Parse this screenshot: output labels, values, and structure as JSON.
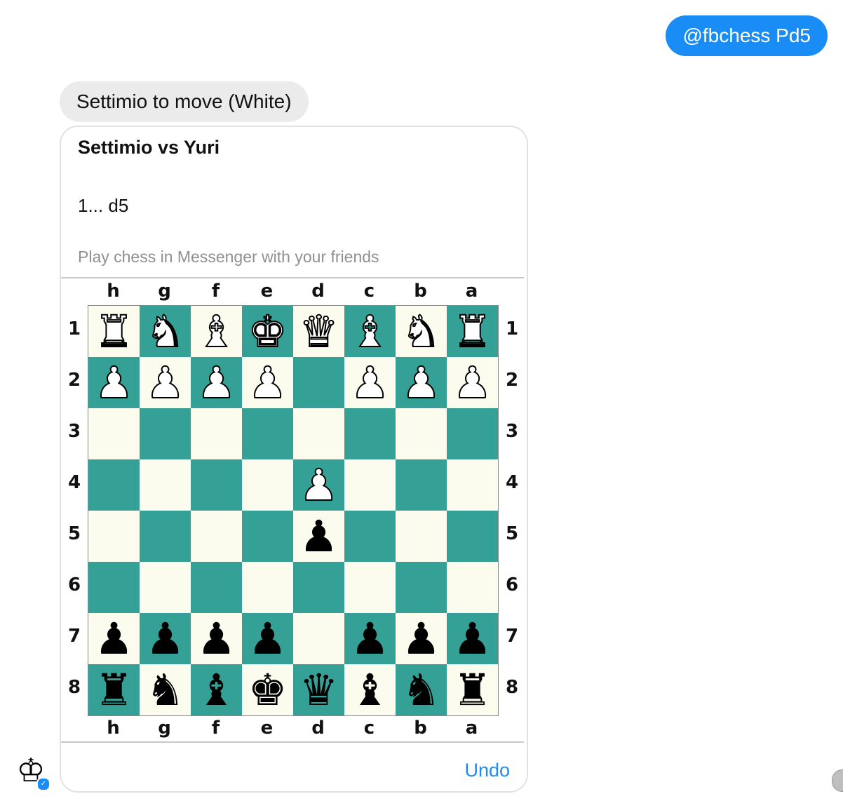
{
  "outgoing_message": "@fbchess Pd5",
  "incoming_message": "Settimio to move (White)",
  "card": {
    "title": "Settimio vs Yuri",
    "move": "1... d5",
    "subtitle": "Play chess in Messenger with your friends",
    "undo_label": "Undo"
  },
  "board": {
    "files": [
      "h",
      "g",
      "f",
      "e",
      "d",
      "c",
      "b",
      "a"
    ],
    "ranks": [
      "1",
      "2",
      "3",
      "4",
      "5",
      "6",
      "7",
      "8"
    ],
    "light_color": "#fbfbee",
    "dark_color": "#34a096",
    "rows": [
      [
        "wR",
        "wN",
        "wB",
        "wK",
        "wQ",
        "wB",
        "wN",
        "wR"
      ],
      [
        "wP",
        "wP",
        "wP",
        "wP",
        "",
        "wP",
        "wP",
        "wP"
      ],
      [
        "",
        "",
        "",
        "",
        "",
        "",
        "",
        ""
      ],
      [
        "",
        "",
        "",
        "",
        "wP",
        "",
        "",
        ""
      ],
      [
        "",
        "",
        "",
        "",
        "bP",
        "",
        "",
        ""
      ],
      [
        "",
        "",
        "",
        "",
        "",
        "",
        "",
        ""
      ],
      [
        "bP",
        "bP",
        "bP",
        "bP",
        "",
        "bP",
        "bP",
        "bP"
      ],
      [
        "bR",
        "bN",
        "bB",
        "bK",
        "bQ",
        "bB",
        "bN",
        "bR"
      ]
    ]
  },
  "bot_avatar_icon": "chess-king-icon",
  "messenger_badge_icon": "messenger-icon",
  "user_avatar_icon": "user-avatar"
}
